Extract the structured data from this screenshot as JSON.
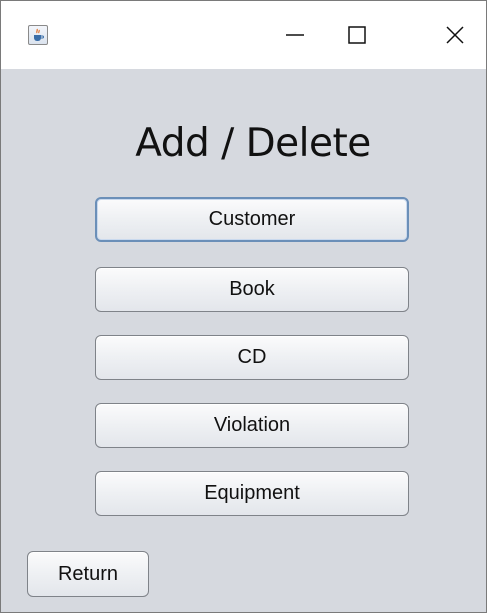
{
  "window": {
    "icon": "java-coffee-cup-icon",
    "controls": [
      "minimize-icon",
      "maximize-icon",
      "close-icon"
    ]
  },
  "main": {
    "heading": "Add / Delete",
    "buttons": [
      {
        "label": "Customer",
        "focused": true
      },
      {
        "label": "Book"
      },
      {
        "label": "CD"
      },
      {
        "label": "Violation"
      },
      {
        "label": "Equipment"
      }
    ],
    "return_label": "Return"
  }
}
